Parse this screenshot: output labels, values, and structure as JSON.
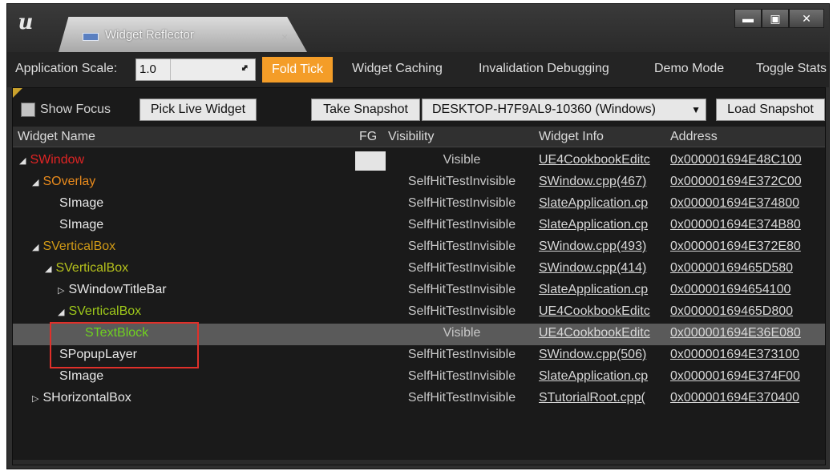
{
  "window": {
    "logo_text": "u",
    "tab_title": "Widget Reflector",
    "tab_close": "×",
    "minimize": "▬",
    "maximize": "▣",
    "close": "✕"
  },
  "toolbar": {
    "app_scale_label": "Application Scale:",
    "app_scale_value": "1.0",
    "fold_tick": "Fold Tick",
    "widget_caching": "Widget Caching",
    "invalidation_debugging": "Invalidation Debugging",
    "demo_mode": "Demo Mode",
    "toggle_stats": "Toggle Stats"
  },
  "panel": {
    "show_focus": "Show Focus",
    "pick_live_widget": "Pick Live Widget",
    "take_snapshot": "Take Snapshot",
    "snapshot_target": "DESKTOP-H7F9AL9-10360 (Windows)",
    "load_snapshot": "Load Snapshot",
    "highlight_color": "#e0302a",
    "accent_color": "#f49d28"
  },
  "columns": {
    "widget_name": "Widget Name",
    "fg": "FG",
    "visibility": "Visibility",
    "widget_info": "Widget Info",
    "address": "Address"
  },
  "rows": [
    {
      "name": "SWindow",
      "indent": 0,
      "expander": "◢",
      "color": "#e02424",
      "visibility": "Visible",
      "info": "UE4CookbookEditc",
      "address": "0x000001694E48C100",
      "fg": true
    },
    {
      "name": "SOverlay",
      "indent": 1,
      "expander": "◢",
      "color": "#e88a1c",
      "visibility": "SelfHitTestInvisible",
      "info": "SWindow.cpp(467)",
      "address": "0x000001694E372C00"
    },
    {
      "name": "SImage",
      "indent": 2,
      "expander": "",
      "color": "#e8e8e8",
      "visibility": "SelfHitTestInvisible",
      "info": "SlateApplication.cp",
      "address": "0x000001694E374800"
    },
    {
      "name": "SImage",
      "indent": 2,
      "expander": "",
      "color": "#e8e8e8",
      "visibility": "SelfHitTestInvisible",
      "info": "SlateApplication.cp",
      "address": "0x000001694E374B80"
    },
    {
      "name": "SVerticalBox",
      "indent": 1,
      "expander": "◢",
      "color": "#d19a16",
      "visibility": "SelfHitTestInvisible",
      "info": "SWindow.cpp(493)",
      "address": "0x000001694E372E80"
    },
    {
      "name": "SVerticalBox",
      "indent": 2,
      "expander": "◢",
      "color": "#b6c21c",
      "visibility": "SelfHitTestInvisible",
      "info": "SWindow.cpp(414)",
      "address": "0x00000169465D580"
    },
    {
      "name": "SWindowTitleBar",
      "indent": 3,
      "expander": "▷",
      "color": "#e8e8e8",
      "visibility": "SelfHitTestInvisible",
      "info": "SlateApplication.cp",
      "address": "0x000001694654100"
    },
    {
      "name": "SVerticalBox",
      "indent": 3,
      "expander": "◢",
      "color": "#9ec81a",
      "visibility": "SelfHitTestInvisible",
      "info": "UE4CookbookEditc",
      "address": "0x00000169465D800"
    },
    {
      "name": "STextBlock",
      "indent": 4,
      "expander": "",
      "color": "#6fd020",
      "visibility": "Visible",
      "info": "UE4CookbookEditc",
      "address": "0x000001694E36E080",
      "selected": true
    },
    {
      "name": "SPopupLayer",
      "indent": 2,
      "expander": "",
      "color": "#e8e8e8",
      "visibility": "SelfHitTestInvisible",
      "info": "SWindow.cpp(506)",
      "address": "0x000001694E373100"
    },
    {
      "name": "SImage",
      "indent": 2,
      "expander": "",
      "color": "#e8e8e8",
      "visibility": "SelfHitTestInvisible",
      "info": "SlateApplication.cp",
      "address": "0x000001694E374F00"
    },
    {
      "name": "SHorizontalBox",
      "indent": 1,
      "expander": "▷",
      "color": "#e8e8e8",
      "visibility": "SelfHitTestInvisible",
      "info": "STutorialRoot.cpp(",
      "address": "0x000001694E370400"
    }
  ]
}
